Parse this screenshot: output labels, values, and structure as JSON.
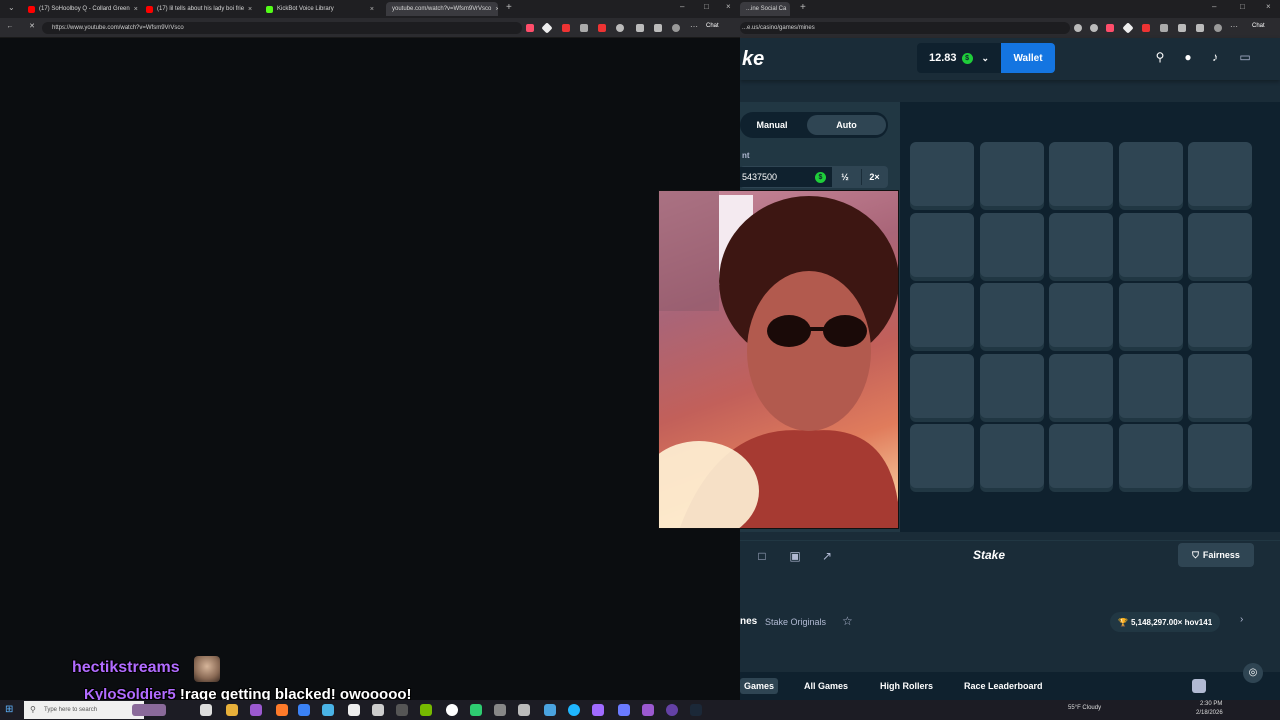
{
  "left_browser": {
    "tabs": [
      {
        "label": "(17) SoHoolboy Q - Collard Green",
        "color": "#ff0000"
      },
      {
        "label": "(17) lil tells about his lady boi frie",
        "color": "#ff0000"
      },
      {
        "label": "KickBot Voice Library",
        "color": "#53fc18"
      },
      {
        "label": "youtube.com/watch?v=Wfsm9VrVsco",
        "color": "#888888"
      }
    ],
    "new_tab": "+",
    "url": "https://www.youtube.com/watch?v=Wfsm9VrVsco",
    "chat_label": "Chat"
  },
  "right_browser": {
    "tab": {
      "label": "...ine Social Ca"
    },
    "new_tab": "+",
    "url": "...e.us/casino/games/mines",
    "chat_label": "Chat"
  },
  "stake": {
    "logo": "ke",
    "balance": "12.83",
    "coin_symbol": "$",
    "wallet_label": "Wallet",
    "mode_tabs": [
      {
        "label": "Manual",
        "active": false
      },
      {
        "label": "Auto",
        "active": true
      }
    ],
    "amount_label": "nt",
    "amount_value": "5437500",
    "half_label": "½",
    "double_label": "2×",
    "grid_rows": 5,
    "grid_cols": 5,
    "footer_logo": "Stake",
    "fairness_label": "Fairness",
    "game_name": "nes",
    "game_category": "Stake Originals",
    "record": "5,148,297.00× hov141",
    "bottom_tabs": [
      {
        "label": "Games",
        "active": true
      },
      {
        "label": "All Games",
        "active": false
      },
      {
        "label": "High Rollers",
        "active": false
      },
      {
        "label": "Race Leaderboard",
        "active": false
      }
    ],
    "colors": {
      "bg": "#1a2c38",
      "panel": "#213743",
      "dark": "#0f212e",
      "tile": "#2f4553",
      "accent": "#1475e1",
      "coin": "#1fce3a"
    }
  },
  "chat_overlay": {
    "streamer_name": "hectikstreams",
    "user": "KyloSoldier5",
    "message": "!rage getting blacked! owooooo!"
  },
  "taskbar": {
    "search_placeholder": "Type here to search",
    "weather": "55°F Cloudy",
    "time": "2:30 PM",
    "date": "2/18/2026"
  }
}
